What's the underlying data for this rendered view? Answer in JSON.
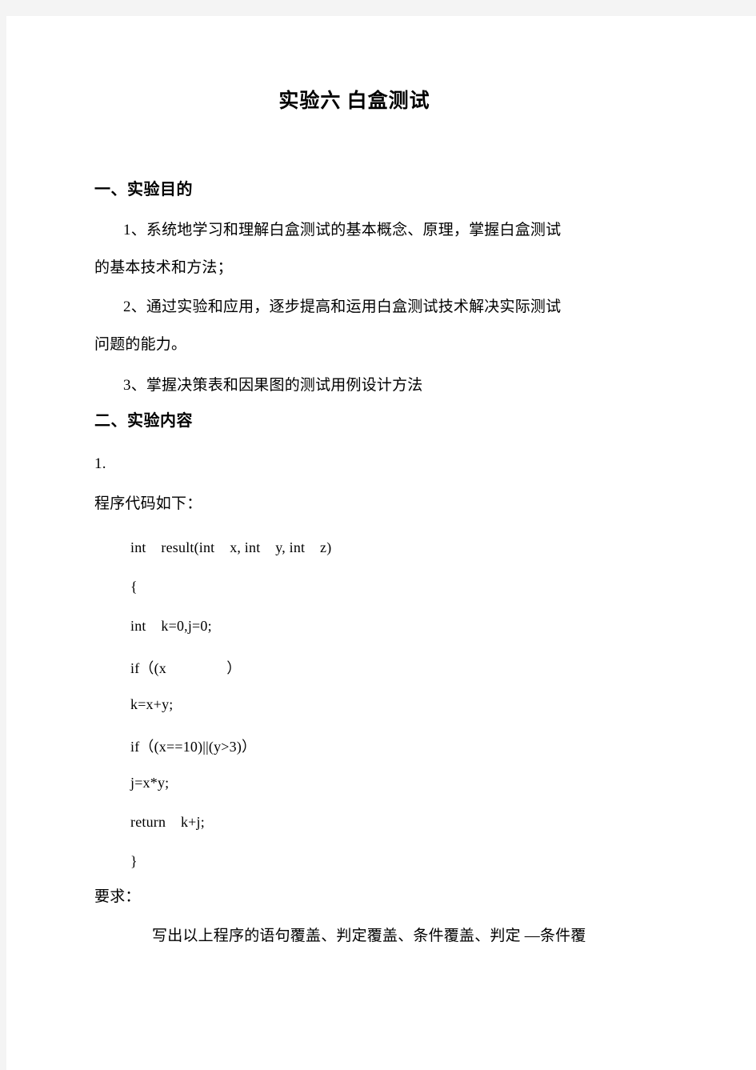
{
  "document": {
    "title": "实验六  白盒测试",
    "sections": [
      {
        "heading": "一、实验目的",
        "items": [
          "1、系统地学习和理解白盒测试的基本概念、原理，掌握白盒测试",
          "的基本技术和方法；",
          "2、通过实验和应用，逐步提高和运用白盒测试技术解决实际测试",
          "问题的能力。",
          "3、掌握决策表和因果图的测试用例设计方法"
        ]
      },
      {
        "heading": "二、实验内容",
        "number_label": "1.",
        "code_intro": "程序代码如下：",
        "code_lines": [
          "int    result(int    x, int    y, int    z)",
          "{",
          "int    k=0,j=0;",
          "if（(x                ）",
          "k=x+y;",
          "if（(x==10)||(y>3)）",
          "j=x*y;",
          "return    k+j;",
          "}"
        ],
        "requirement_label": "要求：",
        "requirement_text": "写出以上程序的语句覆盖、判定覆盖、条件覆盖、判定 —条件覆"
      }
    ]
  },
  "colors": {
    "page_background": "#ffffff",
    "canvas_background": "#f4f4f4",
    "text": "#000000"
  }
}
